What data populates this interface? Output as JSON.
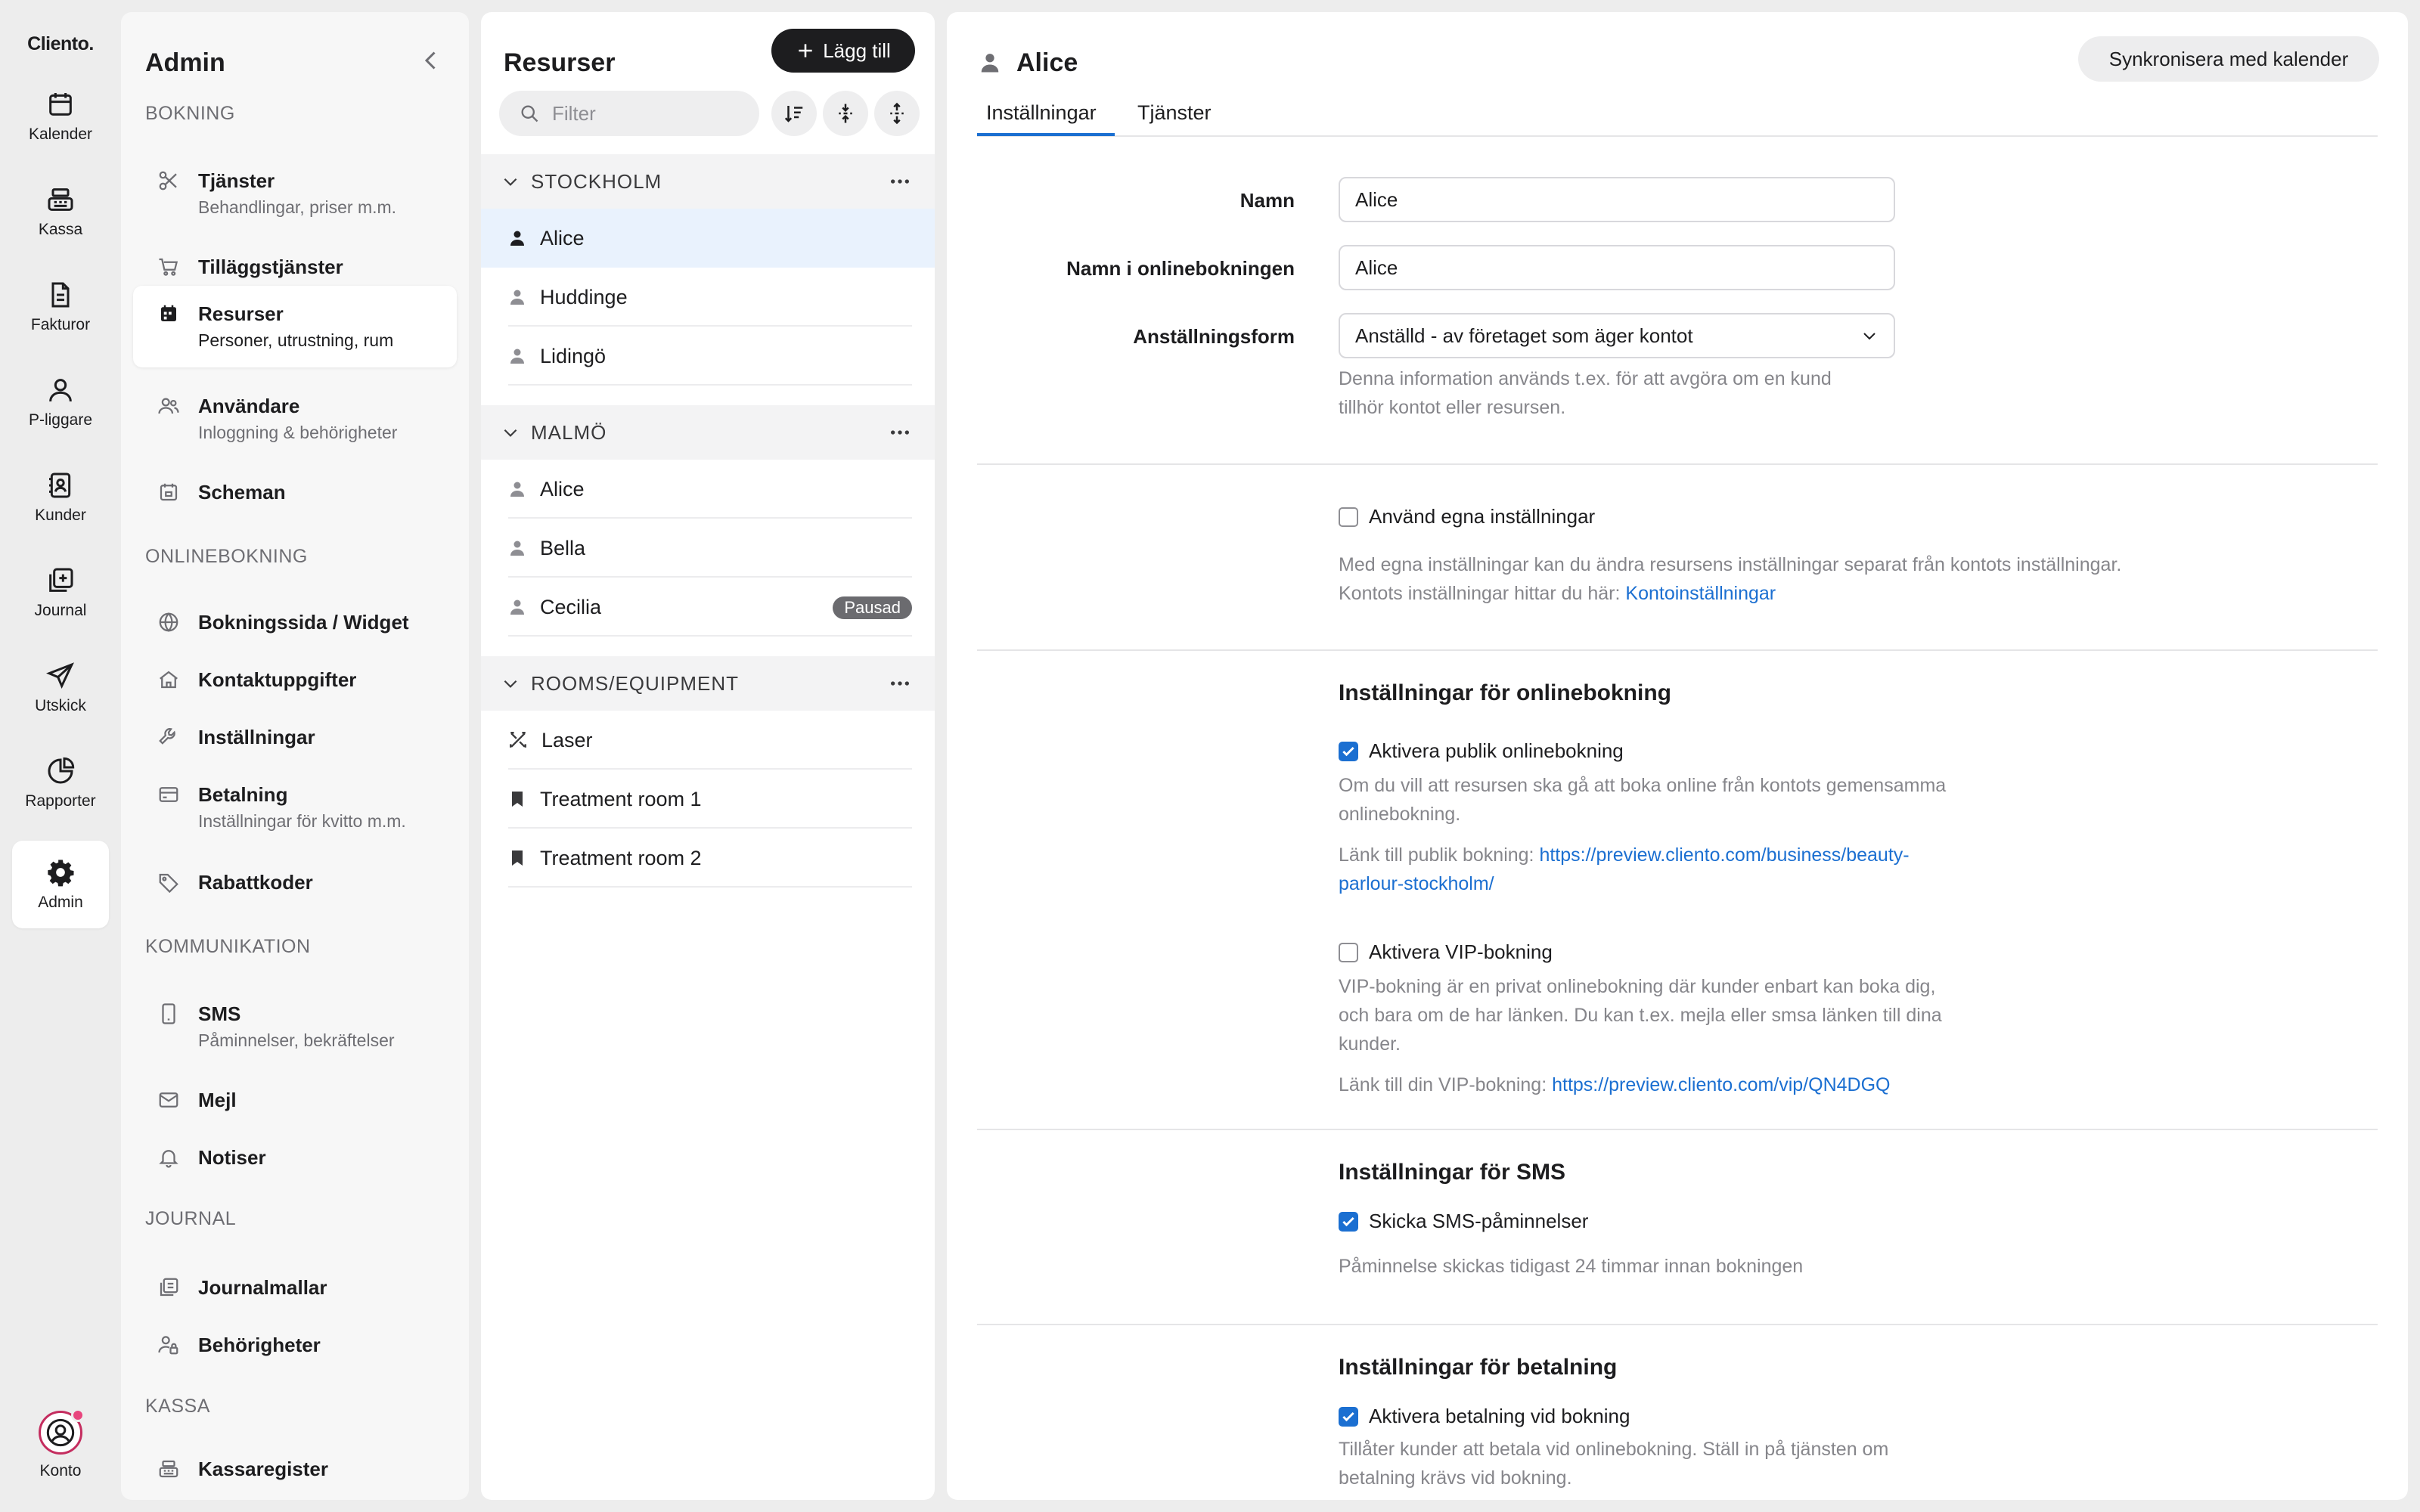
{
  "rail": {
    "logo": "Cliento.",
    "items": [
      {
        "label": "Kalender",
        "icon": "calendar-icon"
      },
      {
        "label": "Kassa",
        "icon": "cash-register-icon"
      },
      {
        "label": "Fakturor",
        "icon": "invoice-icon"
      },
      {
        "label": "P-liggare",
        "icon": "person-icon"
      },
      {
        "label": "Kunder",
        "icon": "contacts-icon"
      },
      {
        "label": "Journal",
        "icon": "journal-icon"
      },
      {
        "label": "Utskick",
        "icon": "send-icon"
      },
      {
        "label": "Rapporter",
        "icon": "pie-chart-icon"
      },
      {
        "label": "Admin",
        "icon": "gear-icon",
        "active": true
      }
    ],
    "account_label": "Konto"
  },
  "admin": {
    "title": "Admin",
    "sections": [
      {
        "heading": "BOKNING",
        "items": [
          {
            "label": "Tjänster",
            "sub": "Behandlingar, priser m.m.",
            "icon": "scissors-icon"
          },
          {
            "label": "Tilläggstjänster",
            "sub": "",
            "icon": "cart-icon"
          },
          {
            "label": "Resurser",
            "sub": "Personer, utrustning, rum",
            "icon": "resources-icon",
            "active": true
          },
          {
            "label": "Användare",
            "sub": "Inloggning & behörigheter",
            "icon": "users-icon"
          },
          {
            "label": "Scheman",
            "sub": "",
            "icon": "schedule-icon"
          }
        ]
      },
      {
        "heading": "ONLINEBOKNING",
        "items": [
          {
            "label": "Bokningssida / Widget",
            "sub": "",
            "icon": "globe-icon"
          },
          {
            "label": "Kontaktuppgifter",
            "sub": "",
            "icon": "home-icon"
          },
          {
            "label": "Inställningar",
            "sub": "",
            "icon": "wrench-icon"
          },
          {
            "label": "Betalning",
            "sub": "Inställningar för kvitto m.m.",
            "icon": "payment-icon"
          },
          {
            "label": "Rabattkoder",
            "sub": "",
            "icon": "tag-icon"
          }
        ]
      },
      {
        "heading": "KOMMUNIKATION",
        "items": [
          {
            "label": "SMS",
            "sub": "Påminnelser, bekräftelser",
            "icon": "phone-icon"
          },
          {
            "label": "Mejl",
            "sub": "",
            "icon": "mail-icon"
          },
          {
            "label": "Notiser",
            "sub": "",
            "icon": "bell-icon"
          }
        ]
      },
      {
        "heading": "JOURNAL",
        "items": [
          {
            "label": "Journalmallar",
            "sub": "",
            "icon": "journal-template-icon"
          },
          {
            "label": "Behörigheter",
            "sub": "",
            "icon": "user-lock-icon"
          }
        ]
      },
      {
        "heading": "KASSA",
        "items": [
          {
            "label": "Kassaregister",
            "sub": "",
            "icon": "cash-register-icon"
          }
        ]
      }
    ]
  },
  "resources": {
    "title": "Resurser",
    "add_label": "Lägg till",
    "filter_placeholder": "Filter",
    "groups": [
      {
        "name": "STOCKHOLM",
        "rows": [
          {
            "name": "Alice",
            "selected": true,
            "icon": "person-icon"
          },
          {
            "name": "Huddinge",
            "icon": "person-icon"
          },
          {
            "name": "Lidingö",
            "icon": "person-icon"
          }
        ]
      },
      {
        "name": "MALMÖ",
        "rows": [
          {
            "name": "Alice",
            "icon": "person-icon"
          },
          {
            "name": "Bella",
            "icon": "person-icon"
          },
          {
            "name": "Cecilia",
            "icon": "person-icon",
            "badge": "Pausad"
          }
        ]
      },
      {
        "name": "ROOMS/EQUIPMENT",
        "rows": [
          {
            "name": "Laser",
            "icon": "tools-icon"
          },
          {
            "name": "Treatment room 1",
            "icon": "bookmark-icon"
          },
          {
            "name": "Treatment room 2",
            "icon": "bookmark-icon"
          }
        ]
      }
    ]
  },
  "detail": {
    "title": "Alice",
    "sync_label": "Synkronisera med kalender",
    "tabs": [
      "Inställningar",
      "Tjänster"
    ],
    "fields": {
      "name_label": "Namn",
      "name_value": "Alice",
      "online_name_label": "Namn i onlinebokningen",
      "online_name_value": "Alice",
      "employment_label": "Anställningsform",
      "employment_value": "Anställd - av företaget som äger kontot",
      "employment_help_1": "Denna information används t.ex. för att avgöra om en kund",
      "employment_help_2": "tillhör kontot eller resursen."
    },
    "own_settings": {
      "label": "Använd egna inställningar",
      "checked": false,
      "help_1": "Med egna inställningar kan du ändra resursens inställningar separat från kontots inställningar.",
      "help_2": "Kontots inställningar hittar du här: ",
      "link": "Kontoinställningar"
    },
    "online": {
      "heading": "Inställningar för onlinebokning",
      "public_label": "Aktivera publik onlinebokning",
      "public_checked": true,
      "public_help_1": "Om du vill att resursen ska gå att boka online från kontots gemensamma",
      "public_help_2": "onlinebokning.",
      "public_link_prefix": "Länk till publik bokning: ",
      "public_link_1": "https://preview.cliento.com/business/beauty-",
      "public_link_2": "parlour-stockholm/",
      "vip_label": "Aktivera VIP-bokning",
      "vip_checked": false,
      "vip_help_1": "VIP-bokning är en privat onlinebokning där kunder enbart kan boka dig,",
      "vip_help_2": "och bara om de har länken. Du kan t.ex. mejla eller smsa länken till dina",
      "vip_help_3": "kunder.",
      "vip_link_prefix": "Länk till din VIP-bokning: ",
      "vip_link": "https://preview.cliento.com/vip/QN4DGQ"
    },
    "sms": {
      "heading": "Inställningar för SMS",
      "label": "Skicka SMS-påminnelser",
      "checked": true,
      "help": "Påminnelse skickas tidigast 24 timmar innan bokningen"
    },
    "payment": {
      "heading": "Inställningar för betalning",
      "label": "Aktivera betalning vid bokning",
      "checked": true,
      "help_1": "Tillåter kunder att betala vid onlinebokning. Ställ in på tjänsten om",
      "help_2": "betalning krävs vid bokning."
    }
  }
}
